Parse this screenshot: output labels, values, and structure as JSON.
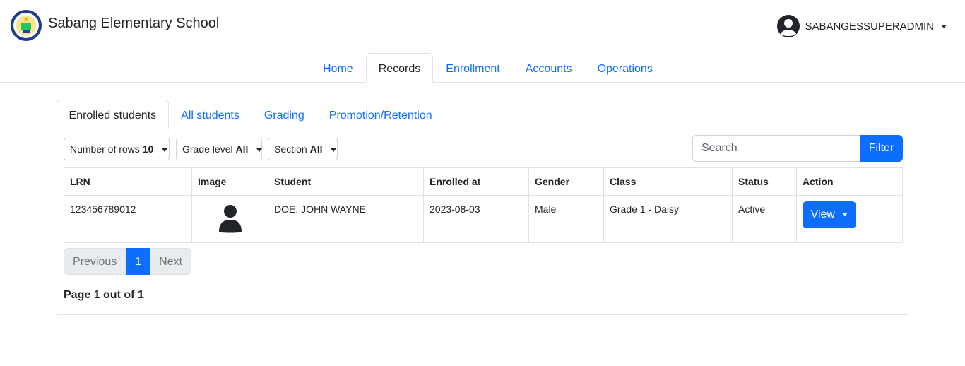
{
  "header": {
    "school_name": "Sabang Elementary School",
    "logo_text": "SABANG ELEMENTARY SCHOOL",
    "user_name": "SABANGESSUPERADMIN"
  },
  "main_tabs": [
    {
      "label": "Home",
      "active": false
    },
    {
      "label": "Records",
      "active": true
    },
    {
      "label": "Enrollment",
      "active": false
    },
    {
      "label": "Accounts",
      "active": false
    },
    {
      "label": "Operations",
      "active": false
    }
  ],
  "sub_tabs": [
    {
      "label": "Enrolled students",
      "active": true
    },
    {
      "label": "All students",
      "active": false
    },
    {
      "label": "Grading",
      "active": false
    },
    {
      "label": "Promotion/Retention",
      "active": false
    }
  ],
  "filters": {
    "rows_label": "Number of rows",
    "rows_value": "10",
    "grade_label": "Grade level",
    "grade_value": "All",
    "section_label": "Section",
    "section_value": "All",
    "search_placeholder": "Search",
    "filter_button": "Filter"
  },
  "table": {
    "columns": [
      "LRN",
      "Image",
      "Student",
      "Enrolled at",
      "Gender",
      "Class",
      "Status",
      "Action"
    ],
    "rows": [
      {
        "lrn": "123456789012",
        "student": "DOE, JOHN WAYNE",
        "enrolled_at": "2023-08-03",
        "gender": "Male",
        "class": "Grade 1 - Daisy",
        "status": "Active",
        "action": "View"
      }
    ]
  },
  "pagination": {
    "previous": "Previous",
    "current": "1",
    "next": "Next",
    "page_info": "Page 1 out of 1"
  },
  "colors": {
    "primary": "#0d6efd",
    "border": "#dee2e6"
  }
}
